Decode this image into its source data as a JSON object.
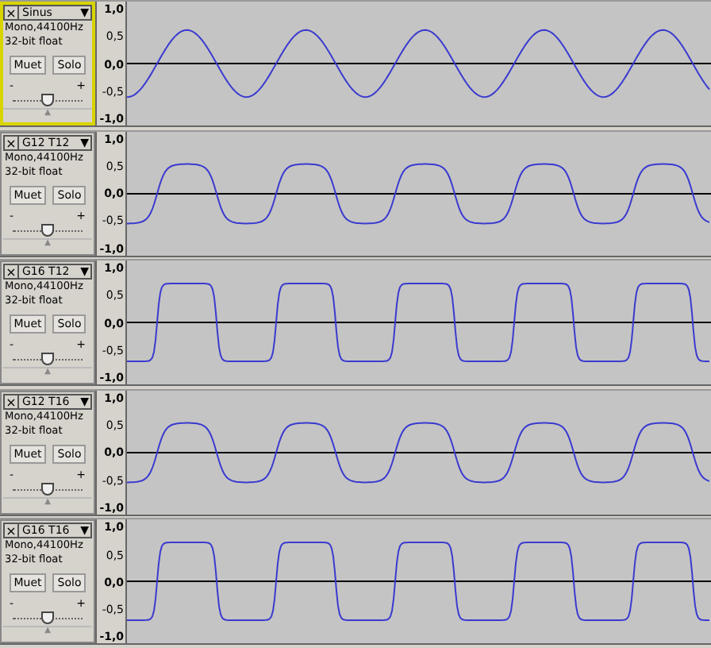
{
  "tracks": [
    {
      "name": "Sinus",
      "selected": true,
      "close": "×",
      "menu": "▼",
      "info": "Mono,44100Hz",
      "format": "32-bit float",
      "mute": "Muet",
      "solo": "Solo",
      "gain": {
        "minus": "-",
        "plus": "+",
        "level": 0.5
      },
      "collapse": "▲",
      "kind": "sine",
      "ruler": [
        "1,0",
        "0,5",
        "0,0",
        "-0,5",
        "-1,0"
      ]
    },
    {
      "name": "G12 T12",
      "selected": false,
      "close": "×",
      "menu": "▼",
      "info": "Mono,44100Hz",
      "format": "32-bit float",
      "mute": "Muet",
      "solo": "Solo",
      "gain": {
        "minus": "-",
        "plus": "+",
        "level": 0.5
      },
      "collapse": "▲",
      "kind": "soft",
      "ruler": [
        "1,0",
        "0,5",
        "0,0",
        "-0,5",
        "-1,0"
      ]
    },
    {
      "name": "G16 T12",
      "selected": false,
      "close": "×",
      "menu": "▼",
      "info": "Mono,44100Hz",
      "format": "32-bit float",
      "mute": "Muet",
      "solo": "Solo",
      "gain": {
        "minus": "-",
        "plus": "+",
        "level": 0.5
      },
      "collapse": "▲",
      "kind": "hard",
      "ruler": [
        "1,0",
        "0,5",
        "0,0",
        "-0,5",
        "-1,0"
      ]
    },
    {
      "name": "G12 T16",
      "selected": false,
      "close": "×",
      "menu": "▼",
      "info": "Mono,44100Hz",
      "format": "32-bit float",
      "mute": "Muet",
      "solo": "Solo",
      "gain": {
        "minus": "-",
        "plus": "+",
        "level": 0.5
      },
      "collapse": "▲",
      "kind": "soft",
      "ruler": [
        "1,0",
        "0,5",
        "0,0",
        "-0,5",
        "-1,0"
      ]
    },
    {
      "name": "G16 T16",
      "selected": false,
      "close": "×",
      "menu": "▼",
      "info": "Mono,44100Hz",
      "format": "32-bit float",
      "mute": "Muet",
      "solo": "Solo",
      "gain": {
        "minus": "-",
        "plus": "+",
        "level": 0.5
      },
      "collapse": "▲",
      "kind": "hard",
      "ruler": [
        "1,0",
        "0,5",
        "0,0",
        "-0,5",
        "-1,0"
      ]
    }
  ]
}
